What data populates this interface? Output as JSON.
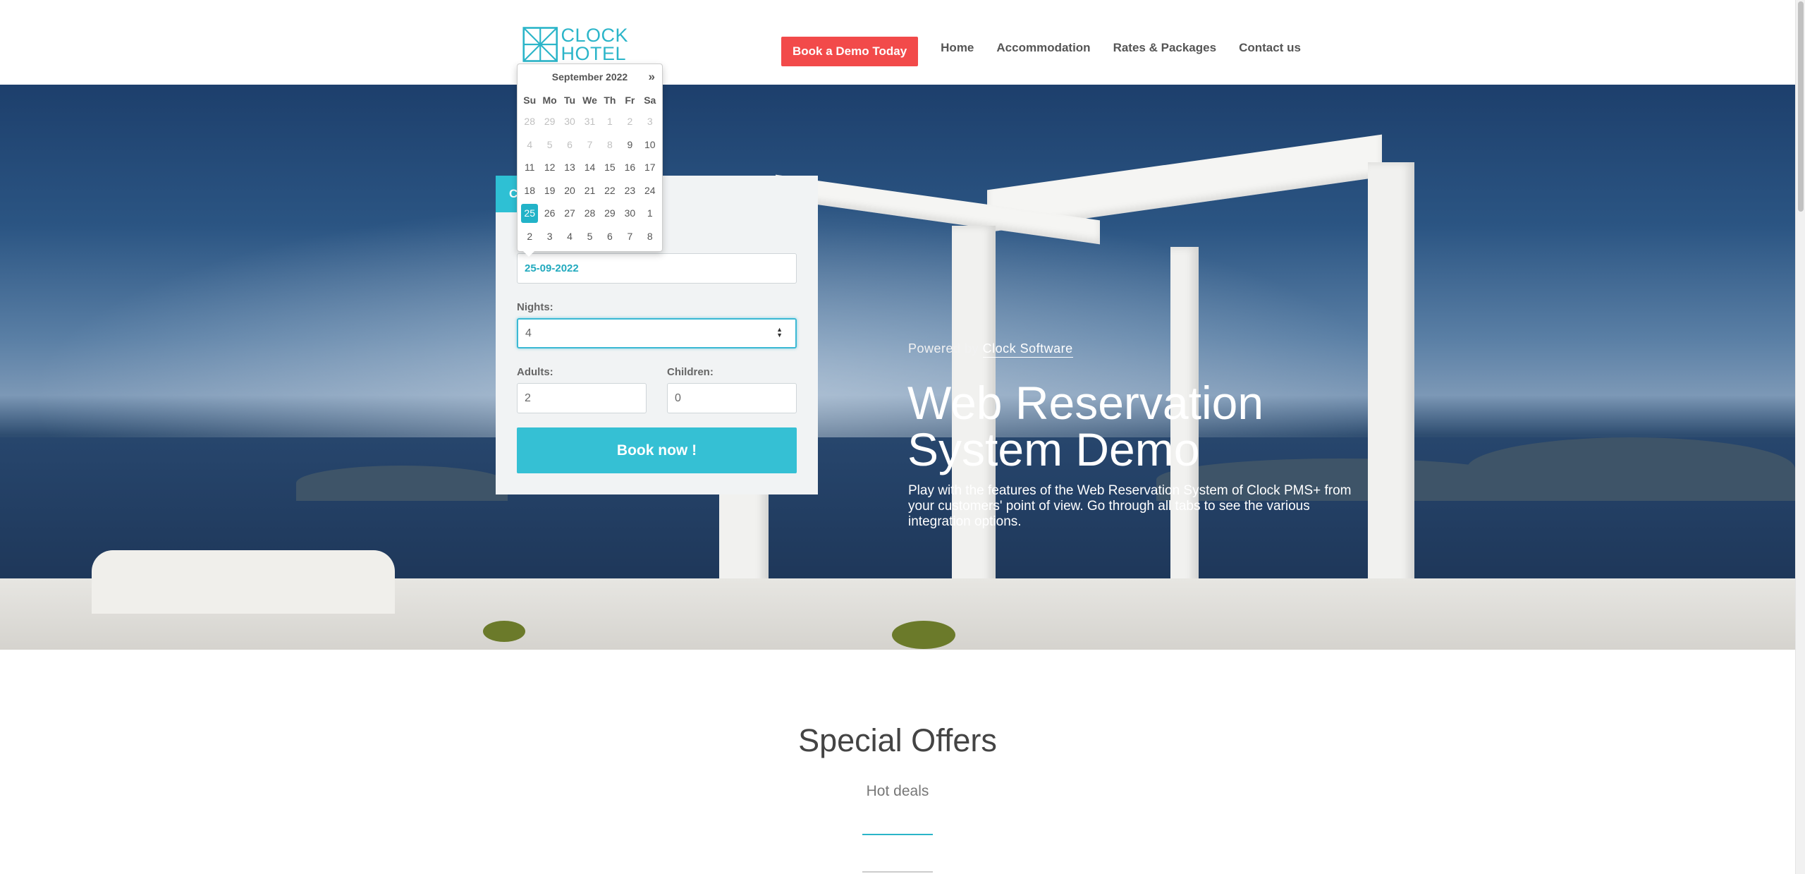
{
  "header": {
    "logo_line1": "CLOCK",
    "logo_line2": "HOTEL",
    "demo_button": "Book a Demo Today",
    "nav": [
      "Home",
      "Accommodation",
      "Rates & Packages",
      "Contact us"
    ]
  },
  "hero": {
    "powered_prefix": "Powered by",
    "powered_link": "Clock Software",
    "title_line1": "Web Reservation",
    "title_line2": "System Demo",
    "description": "Play with the features of the Web Reservation System of Clock PMS+ from your customers' point of view. Go through all tabs to see the various integration options."
  },
  "booking": {
    "tab_label": "C",
    "arrival_value": "25-09-2022",
    "nights_label": "Nights:",
    "nights_value": "4",
    "adults_label": "Adults:",
    "adults_value": "2",
    "children_label": "Children:",
    "children_value": "0",
    "book_button": "Book now !"
  },
  "datepicker": {
    "month_label": "September 2022",
    "next_label": "»",
    "weekdays": [
      "Su",
      "Mo",
      "Tu",
      "We",
      "Th",
      "Fr",
      "Sa"
    ],
    "days": [
      {
        "d": "28",
        "m": true
      },
      {
        "d": "29",
        "m": true
      },
      {
        "d": "30",
        "m": true
      },
      {
        "d": "31",
        "m": true
      },
      {
        "d": "1",
        "m": true
      },
      {
        "d": "2",
        "m": true
      },
      {
        "d": "3",
        "m": true
      },
      {
        "d": "4",
        "m": true
      },
      {
        "d": "5",
        "m": true
      },
      {
        "d": "6",
        "m": true
      },
      {
        "d": "7",
        "m": true
      },
      {
        "d": "8",
        "m": true
      },
      {
        "d": "9"
      },
      {
        "d": "10"
      },
      {
        "d": "11"
      },
      {
        "d": "12"
      },
      {
        "d": "13"
      },
      {
        "d": "14"
      },
      {
        "d": "15"
      },
      {
        "d": "16"
      },
      {
        "d": "17"
      },
      {
        "d": "18"
      },
      {
        "d": "19"
      },
      {
        "d": "20"
      },
      {
        "d": "21"
      },
      {
        "d": "22"
      },
      {
        "d": "23"
      },
      {
        "d": "24"
      },
      {
        "d": "25",
        "a": true
      },
      {
        "d": "26"
      },
      {
        "d": "27"
      },
      {
        "d": "28"
      },
      {
        "d": "29"
      },
      {
        "d": "30"
      },
      {
        "d": "1"
      },
      {
        "d": "2"
      },
      {
        "d": "3"
      },
      {
        "d": "4"
      },
      {
        "d": "5"
      },
      {
        "d": "6"
      },
      {
        "d": "7"
      },
      {
        "d": "8"
      }
    ]
  },
  "offers": {
    "title": "Special Offers",
    "subtitle": "Hot deals"
  },
  "colors": {
    "accent": "#2bb5c9",
    "demo_button": "#f24a4a"
  }
}
